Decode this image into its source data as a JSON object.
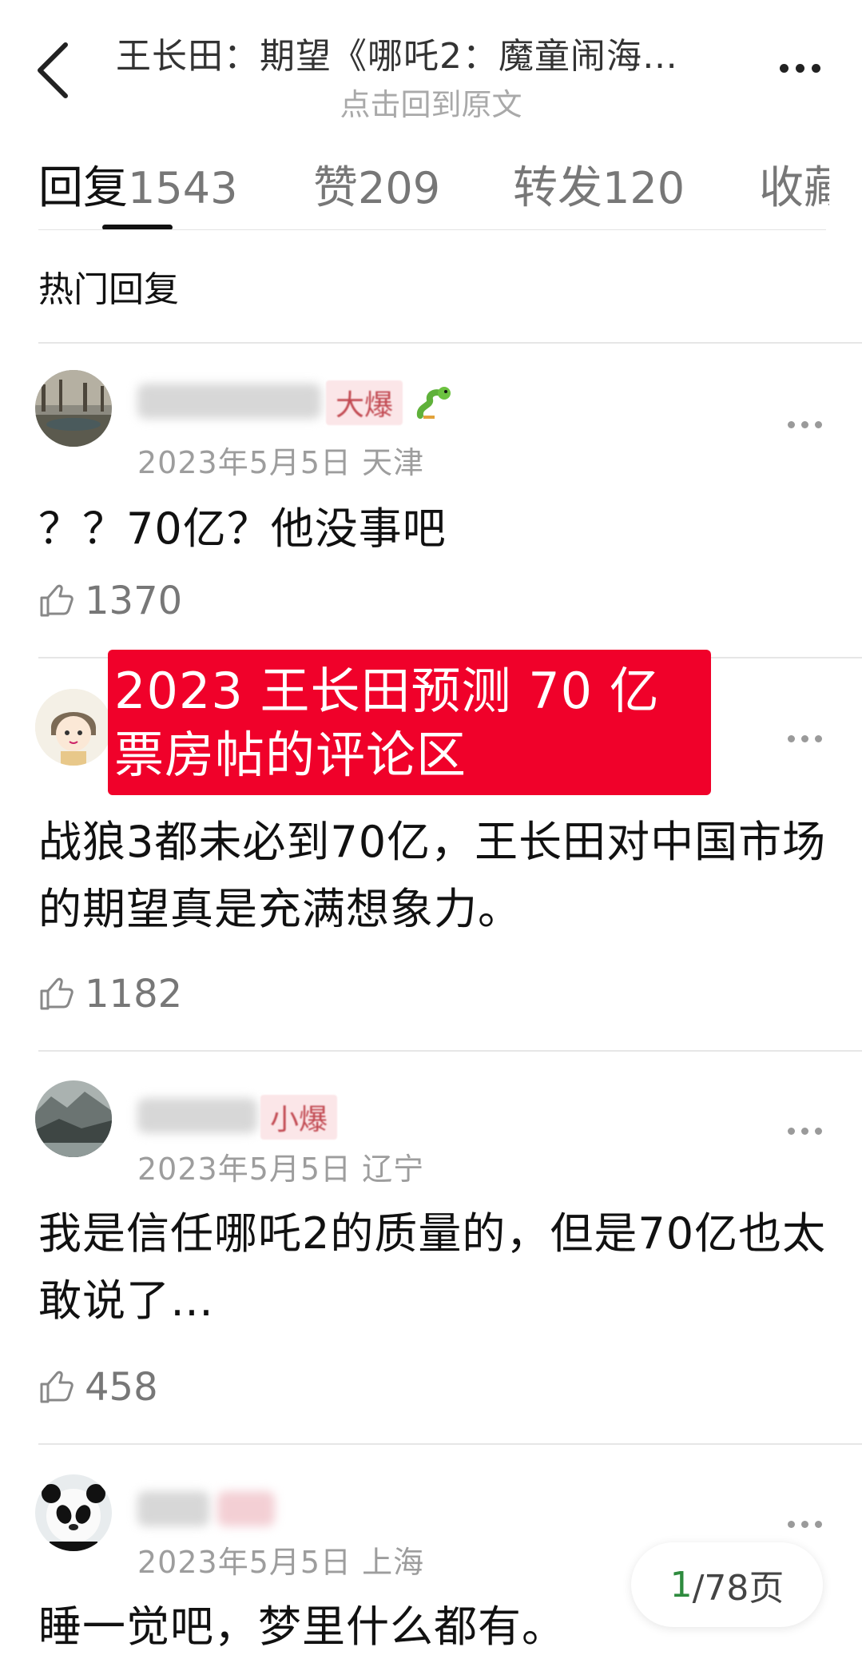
{
  "header": {
    "title": "王长田：期望《哪吒2：魔童闹海…",
    "subtitle": "点击回到原文",
    "back_icon": "back-arrow-icon",
    "more_icon": "more-dots-icon"
  },
  "tabs": [
    {
      "label": "回复",
      "count": "1543",
      "active": true
    },
    {
      "label": "赞",
      "count": "209",
      "active": false
    },
    {
      "label": "转发",
      "count": "120",
      "active": false
    },
    {
      "label": "收藏",
      "count": "",
      "active": false
    }
  ],
  "section_label": "热门回复",
  "comments": [
    {
      "badge": "大爆",
      "meta": "2023年5月5日 天津",
      "content": "？？70亿？他没事吧",
      "likes": "1370"
    },
    {
      "badge": "",
      "meta": "",
      "content": "战狼3都未必到70亿，王长田对中国市场的期望真是充满想象力。",
      "likes": "1182"
    },
    {
      "badge": "小爆",
      "meta": "2023年5月5日 辽宁",
      "content": "我是信任哪吒2的质量的，但是70亿也太敢说了…",
      "likes": "458"
    },
    {
      "badge": "",
      "meta": "2023年5月5日 上海",
      "content": "睡一觉吧，梦里什么都有。",
      "likes": ""
    }
  ],
  "banner": {
    "text": "2023 王长田预测 70 亿\n票房帖的评论区",
    "color": "#f0012a"
  },
  "pager": {
    "current": "1",
    "rest": "/78页"
  },
  "colors": {
    "badge_text": "#c24a52",
    "pager_current": "#2e8b3e"
  }
}
